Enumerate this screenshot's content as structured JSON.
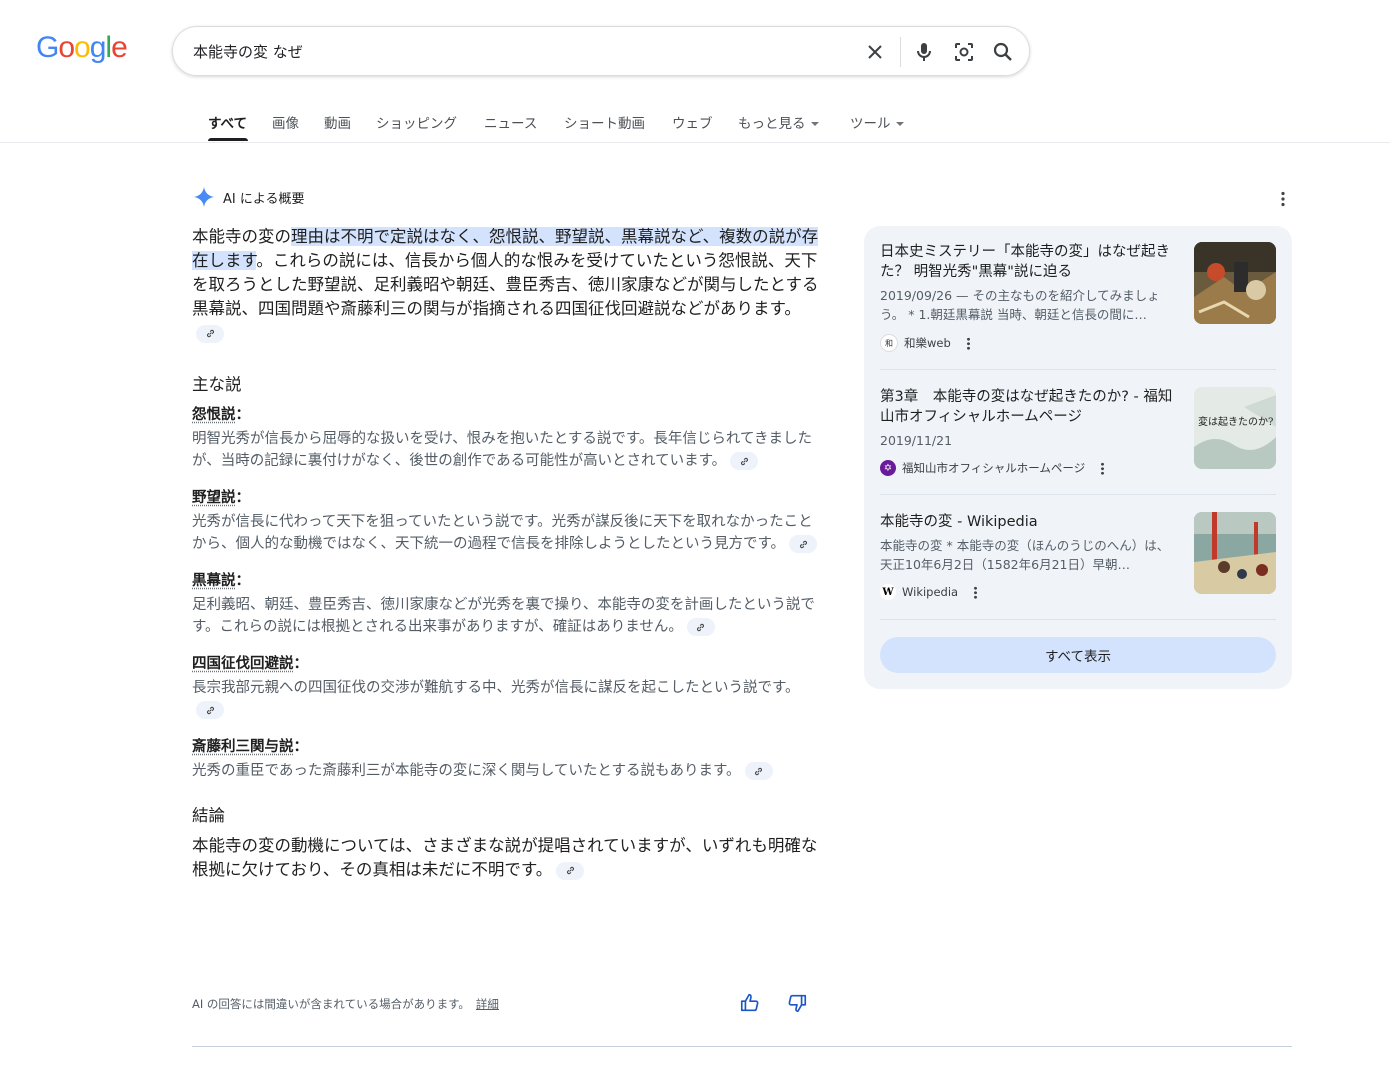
{
  "logo": {
    "letters": [
      "G",
      "o",
      "o",
      "g",
      "l",
      "e"
    ],
    "colors": [
      "#4285f4",
      "#ea4335",
      "#fbbc05",
      "#4285f4",
      "#34a853",
      "#ea4335"
    ]
  },
  "search": {
    "query": "本能寺の変 なぜ"
  },
  "tabs": [
    "すべて",
    "画像",
    "動画",
    "ショッピング",
    "ニュース",
    "ショート動画",
    "ウェブ",
    "もっと見る",
    "ツール"
  ],
  "ai": {
    "header": "AI による概要",
    "intro_pre": "本能寺の変の",
    "intro_highlight": "理由は不明で定説はなく、怨恨説、野望説、黒幕説など、複数の説が存在します",
    "intro_post": "。これらの説には、信長から個人的な恨みを受けていたという怨恨説、天下を取ろうとした野望説、足利義昭や朝廷、豊臣秀吉、徳川家康などが関与したとする黒幕説、四国問題や斎藤利三の関与が指摘される四国征伐回避説などがあります。",
    "main_heading": "主な説",
    "theories": [
      {
        "name": "怨恨説",
        "colon": "：",
        "text": "明智光秀が信長から屈辱的な扱いを受け、恨みを抱いたとする説です。長年信じられてきましたが、当時の記録に裏付けがなく、後世の創作である可能性が高いとされています。"
      },
      {
        "name": "野望説",
        "colon": "：",
        "text": "光秀が信長に代わって天下を狙っていたという説です。光秀が謀反後に天下を取れなかったことから、個人的な動機ではなく、天下統一の過程で信長を排除しようとしたという見方です。"
      },
      {
        "name": "黒幕説",
        "colon": "：",
        "text": "足利義昭、朝廷、豊臣秀吉、徳川家康などが光秀を裏で操り、本能寺の変を計画したという説です。これらの説には根拠とされる出来事がありますが、確証はありません。"
      },
      {
        "name": "四国征伐回避説",
        "colon": "：",
        "text": "長宗我部元親への四国征伐の交渉が難航する中、光秀が信長に謀反を起こしたという説です。"
      },
      {
        "name": "斎藤利三関与説",
        "colon": "：",
        "text": "光秀の重臣であった斎藤利三が本能寺の変に深く関与していたとする説もあります。"
      }
    ],
    "conclusion_heading": "結論",
    "conclusion": "本能寺の変の動機については、さまざまな説が提唱されていますが、いずれも明確な根拠に欠けており、その真相は未だに不明です。",
    "disclaimer": "AI の回答には間違いが含まれている場合があります。",
    "details_link": "詳細"
  },
  "sources": [
    {
      "title": "日本史ミステリー「本能寺の変」はなぜ起きた？ 明智光秀\"黒幕\"説に迫る",
      "snippet": "2019/09/26 — その主なものを紹介してみましょう。 * 1.朝廷黒幕説 当時、朝廷と信長の間に…",
      "site": "和樂web",
      "fav": "和",
      "fav_color": "#ffffff"
    },
    {
      "title": "第3章　本能寺の変はなぜ起きたのか? - 福知山市オフィシャルホームページ",
      "snippet": "2019/11/21",
      "site": "福知山市オフィシャルホームページ",
      "fav": "✡",
      "fav_color": "#6a1b9a"
    },
    {
      "title": "本能寺の変 - Wikipedia",
      "snippet": "本能寺の変 * 本能寺の変（ほんのうじのへん）は、天正10年6月2日（1582年6月21日）早朝…",
      "site": "Wikipedia",
      "fav": "W",
      "fav_color": "#ffffff"
    }
  ],
  "thumb2_text": "変は起きたのか?",
  "show_all": "すべて表示"
}
